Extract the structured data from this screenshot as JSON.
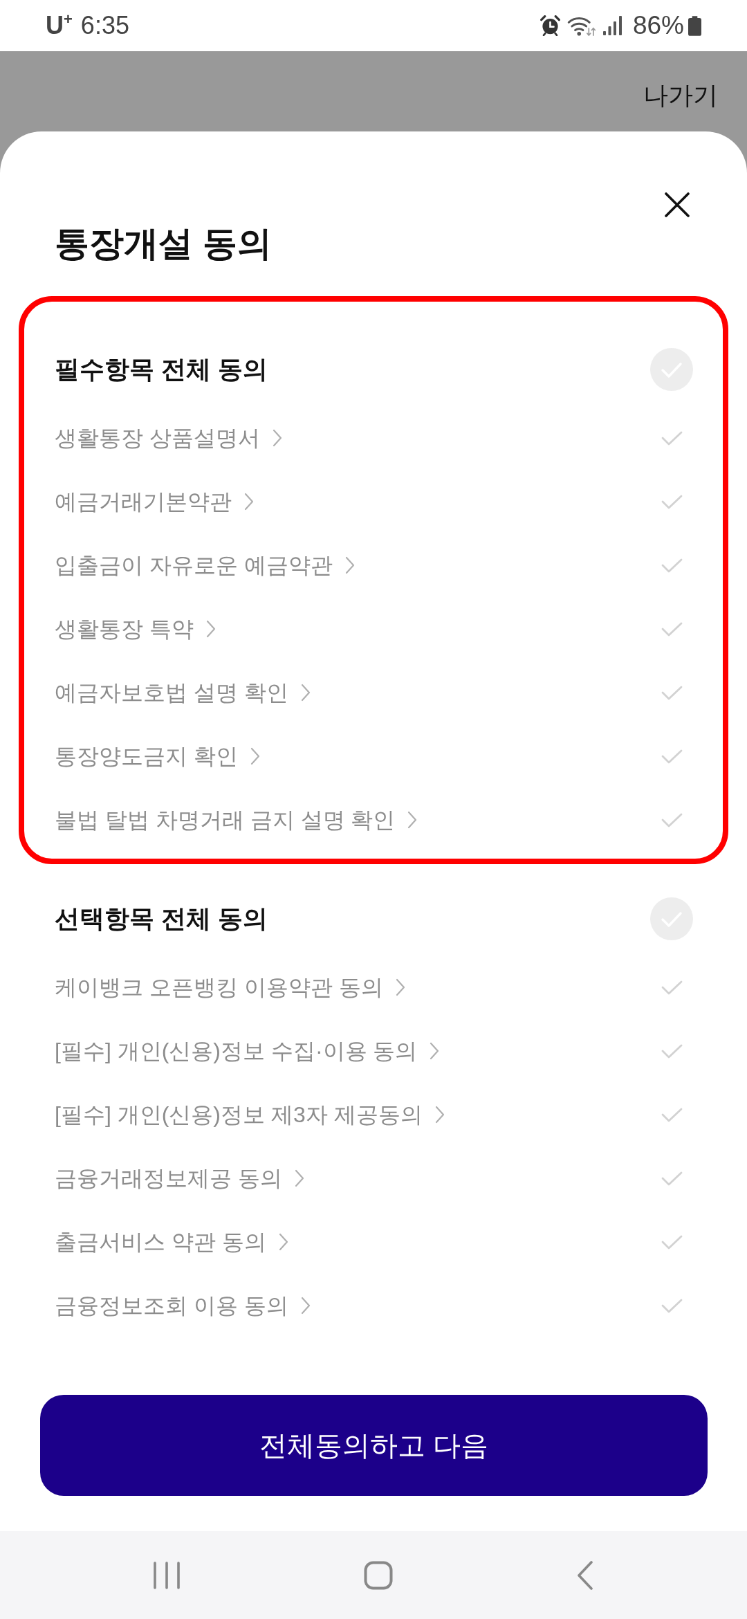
{
  "status_bar": {
    "carrier": "U$^{+}$",
    "time": "6:35",
    "battery": "86%"
  },
  "top_bar": {
    "exit_label": "나가기"
  },
  "sheet": {
    "title": "통장개설 동의",
    "sections": [
      {
        "title": "필수항목 전체 동의",
        "checked": false,
        "highlighted": true,
        "items": [
          {
            "label": "생활통장 상품설명서",
            "checked": false
          },
          {
            "label": "예금거래기본약관",
            "checked": false
          },
          {
            "label": "입출금이 자유로운 예금약관",
            "checked": false
          },
          {
            "label": "생활통장 특약",
            "checked": false
          },
          {
            "label": "예금자보호법 설명 확인",
            "checked": false
          },
          {
            "label": "통장양도금지 확인",
            "checked": false
          },
          {
            "label": "불법 탈법 차명거래 금지 설명 확인",
            "checked": false
          }
        ]
      },
      {
        "title": "선택항목 전체 동의",
        "checked": false,
        "highlighted": false,
        "items": [
          {
            "label": "케이뱅크 오픈뱅킹 이용약관 동의",
            "checked": false
          },
          {
            "label": "[필수] 개인(신용)정보 수집·이용 동의",
            "checked": false
          },
          {
            "label": "[필수] 개인(신용)정보 제3자 제공동의",
            "checked": false
          },
          {
            "label": "금융거래정보제공 동의",
            "checked": false
          },
          {
            "label": "출금서비스 약관 동의",
            "checked": false
          },
          {
            "label": "금융정보조회 이용 동의",
            "checked": false
          }
        ]
      }
    ],
    "button": "전체동의하고 다음"
  }
}
